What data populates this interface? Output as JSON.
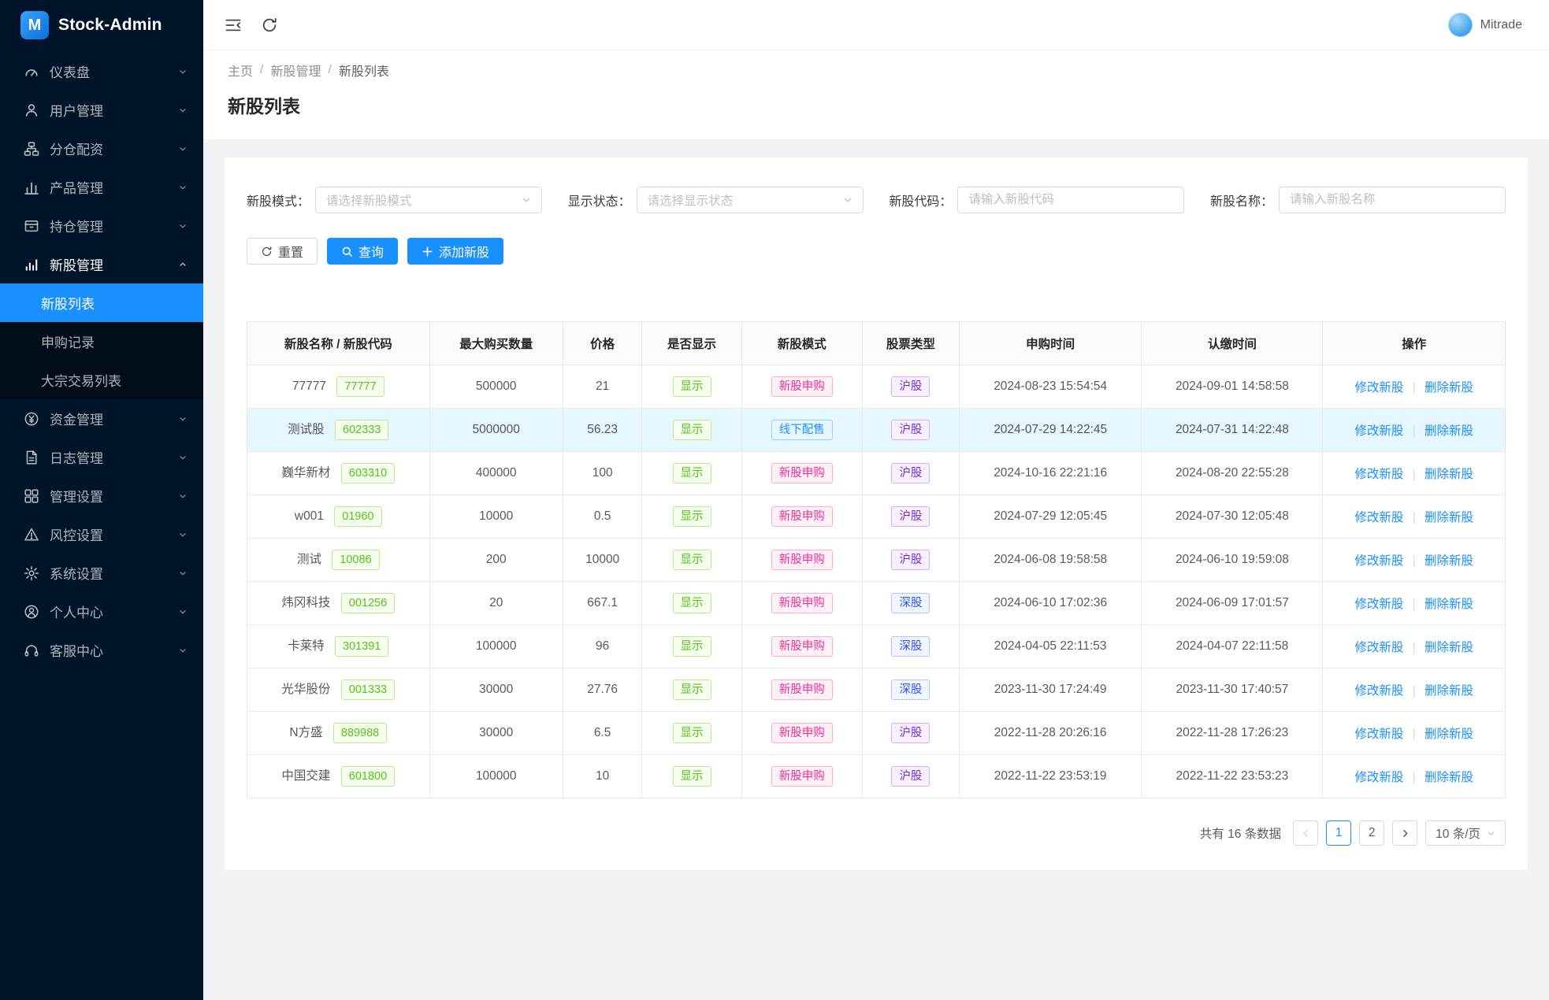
{
  "app": {
    "title": "Stock-Admin",
    "user": "Mitrade"
  },
  "colors": {
    "primary": "#1890ff",
    "sidebar_bg": "#001529",
    "submenu_bg": "#000c17",
    "active_menu_bg": "#1890ff",
    "content_bg": "#f0f2f5",
    "highlight_row_bg": "#e6f7ff",
    "tag_green": "#52c41a",
    "tag_magenta": "#eb2f96",
    "tag_blue": "#1890ff",
    "tag_purple": "#722ed1",
    "tag_geekblue": "#2f54eb"
  },
  "sidebar": {
    "items": [
      {
        "label": "仪表盘",
        "icon": "dashboard-icon"
      },
      {
        "label": "用户管理",
        "icon": "user-icon"
      },
      {
        "label": "分仓配资",
        "icon": "cluster-icon"
      },
      {
        "label": "产品管理",
        "icon": "product-icon"
      },
      {
        "label": "持仓管理",
        "icon": "position-icon"
      },
      {
        "label": "新股管理",
        "icon": "stock-icon",
        "expanded": true,
        "children": [
          {
            "label": "新股列表",
            "active": true
          },
          {
            "label": "申购记录"
          },
          {
            "label": "大宗交易列表"
          }
        ]
      },
      {
        "label": "资金管理",
        "icon": "money-icon"
      },
      {
        "label": "日志管理",
        "icon": "log-icon"
      },
      {
        "label": "管理设置",
        "icon": "manage-icon"
      },
      {
        "label": "风控设置",
        "icon": "risk-icon"
      },
      {
        "label": "系统设置",
        "icon": "system-icon"
      },
      {
        "label": "个人中心",
        "icon": "profile-icon"
      },
      {
        "label": "客服中心",
        "icon": "support-icon"
      }
    ]
  },
  "breadcrumb": {
    "items": [
      "主页",
      "新股管理",
      "新股列表"
    ],
    "separator": "/"
  },
  "page_title": "新股列表",
  "filters": {
    "groups": [
      {
        "label": "新股模式：",
        "placeholder": "请选择新股模式",
        "control": "select"
      },
      {
        "label": "显示状态：",
        "placeholder": "请选择显示状态",
        "control": "select"
      },
      {
        "label": "新股代码：",
        "placeholder": "请输入新股代码",
        "control": "input"
      },
      {
        "label": "新股名称：",
        "placeholder": "请输入新股名称",
        "control": "input"
      }
    ],
    "reset": "重置",
    "search": "查询",
    "add": "添加新股"
  },
  "table": {
    "columns": [
      "新股名称 / 新股代码",
      "最大购买数量",
      "价格",
      "是否显示",
      "新股模式",
      "股票类型",
      "申购时间",
      "认缴时间",
      "操作"
    ],
    "ops": {
      "edit": "修改新股",
      "divider": "|",
      "delete": "删除新股"
    },
    "rows": [
      {
        "name": "77777",
        "code": "77777",
        "max_buy": "500000",
        "price": "21",
        "visible": "显示",
        "mode": "新股申购",
        "mode_color": "magenta",
        "stock_type": "沪股",
        "stock_type_color": "purple",
        "apply_time": "2024-08-23 15:54:54",
        "pay_time": "2024-09-01 14:58:58",
        "highlight": false
      },
      {
        "name": "测试股",
        "code": "602333",
        "max_buy": "5000000",
        "price": "56.23",
        "visible": "显示",
        "mode": "线下配售",
        "mode_color": "blue",
        "stock_type": "沪股",
        "stock_type_color": "purple",
        "apply_time": "2024-07-29 14:22:45",
        "pay_time": "2024-07-31 14:22:48",
        "highlight": true
      },
      {
        "name": "巍华新材",
        "code": "603310",
        "max_buy": "400000",
        "price": "100",
        "visible": "显示",
        "mode": "新股申购",
        "mode_color": "magenta",
        "stock_type": "沪股",
        "stock_type_color": "purple",
        "apply_time": "2024-10-16 22:21:16",
        "pay_time": "2024-08-20 22:55:28",
        "highlight": false
      },
      {
        "name": "w001",
        "code": "01960",
        "max_buy": "10000",
        "price": "0.5",
        "visible": "显示",
        "mode": "新股申购",
        "mode_color": "magenta",
        "stock_type": "沪股",
        "stock_type_color": "purple",
        "apply_time": "2024-07-29 12:05:45",
        "pay_time": "2024-07-30 12:05:48",
        "highlight": false
      },
      {
        "name": "测试",
        "code": "10086",
        "max_buy": "200",
        "price": "10000",
        "visible": "显示",
        "mode": "新股申购",
        "mode_color": "magenta",
        "stock_type": "沪股",
        "stock_type_color": "purple",
        "apply_time": "2024-06-08 19:58:58",
        "pay_time": "2024-06-10 19:59:08",
        "highlight": false
      },
      {
        "name": "炜冈科技",
        "code": "001256",
        "max_buy": "20",
        "price": "667.1",
        "visible": "显示",
        "mode": "新股申购",
        "mode_color": "magenta",
        "stock_type": "深股",
        "stock_type_color": "geekblue",
        "apply_time": "2024-06-10 17:02:36",
        "pay_time": "2024-06-09 17:01:57",
        "highlight": false
      },
      {
        "name": "卡莱特",
        "code": "301391",
        "max_buy": "100000",
        "price": "96",
        "visible": "显示",
        "mode": "新股申购",
        "mode_color": "magenta",
        "stock_type": "深股",
        "stock_type_color": "geekblue",
        "apply_time": "2024-04-05 22:11:53",
        "pay_time": "2024-04-07 22:11:58",
        "highlight": false
      },
      {
        "name": "光华股份",
        "code": "001333",
        "max_buy": "30000",
        "price": "27.76",
        "visible": "显示",
        "mode": "新股申购",
        "mode_color": "magenta",
        "stock_type": "深股",
        "stock_type_color": "geekblue",
        "apply_time": "2023-11-30 17:24:49",
        "pay_time": "2023-11-30 17:40:57",
        "highlight": false
      },
      {
        "name": "N方盛",
        "code": "889988",
        "max_buy": "30000",
        "price": "6.5",
        "visible": "显示",
        "mode": "新股申购",
        "mode_color": "magenta",
        "stock_type": "沪股",
        "stock_type_color": "purple",
        "apply_time": "2022-11-28 20:26:16",
        "pay_time": "2022-11-28 17:26:23",
        "highlight": false
      },
      {
        "name": "中国交建",
        "code": "601800",
        "max_buy": "100000",
        "price": "10",
        "visible": "显示",
        "mode": "新股申购",
        "mode_color": "magenta",
        "stock_type": "沪股",
        "stock_type_color": "purple",
        "apply_time": "2022-11-22 23:53:19",
        "pay_time": "2022-11-22 23:53:23",
        "highlight": false
      }
    ]
  },
  "pagination": {
    "total": "共有 16 条数据",
    "pages": [
      "1",
      "2"
    ],
    "active_page": "1",
    "page_size": "10 条/页"
  }
}
